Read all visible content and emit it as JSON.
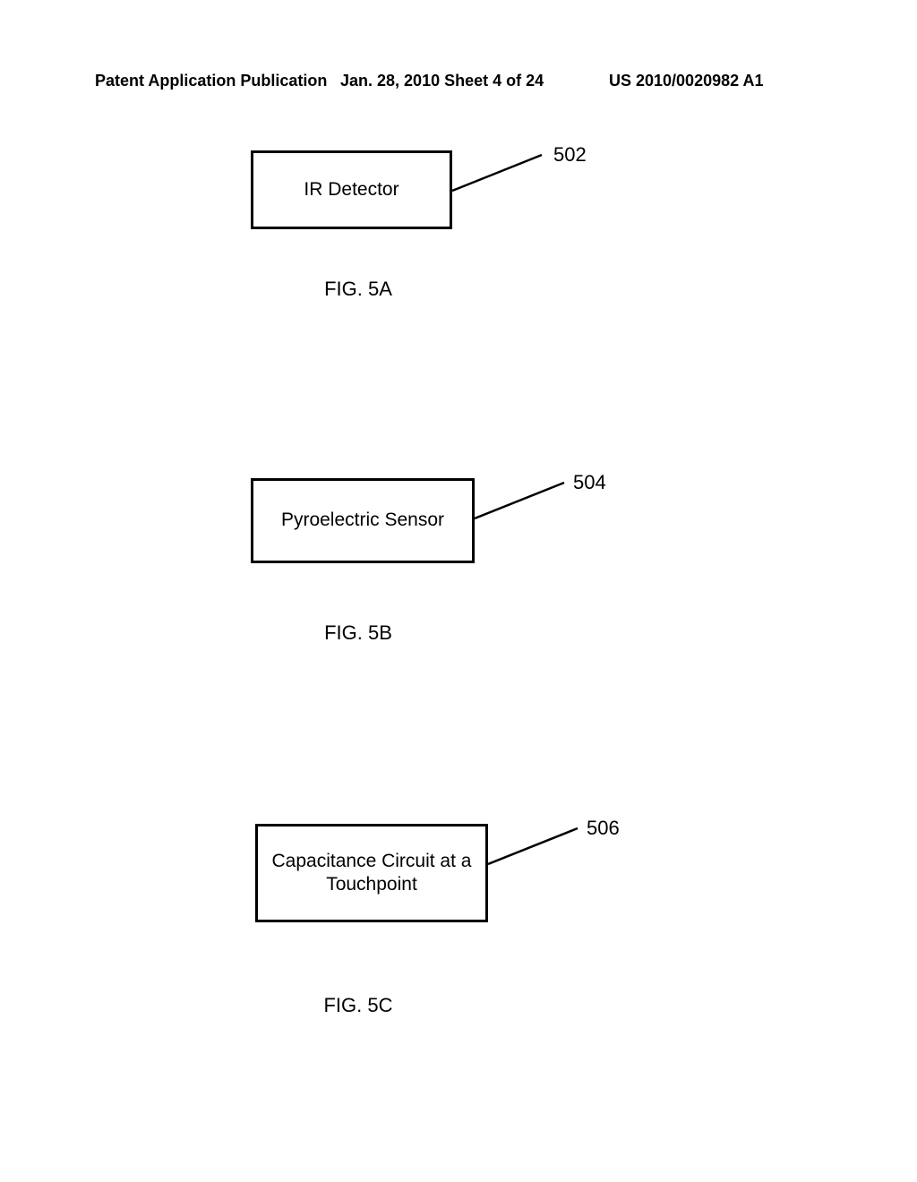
{
  "header": {
    "left": "Patent Application Publication",
    "center": "Jan. 28, 2010  Sheet 4 of 24",
    "right": "US 2010/0020982 A1"
  },
  "figures": {
    "a": {
      "box_text": "IR Detector",
      "ref": "502",
      "caption": "FIG. 5A"
    },
    "b": {
      "box_text": "Pyroelectric Sensor",
      "ref": "504",
      "caption": "FIG. 5B"
    },
    "c": {
      "box_text": "Capacitance Circuit at a Touchpoint",
      "ref": "506",
      "caption": "FIG. 5C"
    }
  }
}
